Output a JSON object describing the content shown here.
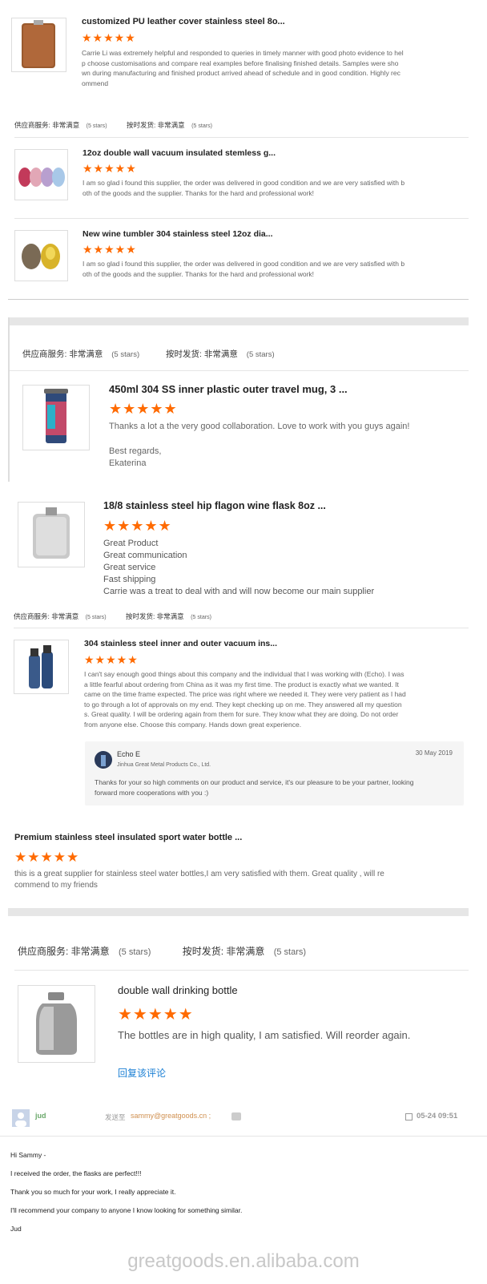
{
  "stars": "★★★★★",
  "meta_service_label": "供应商服务: 非常满意",
  "meta_ship_label": "按时发货: 非常满意",
  "meta_stars_text": "(5 stars)",
  "reviews_block1": [
    {
      "title": "customized PU leather cover stainless steel 8o...",
      "body": "Carrie Li was extremely helpful and responded to queries in timely manner with good photo evidence to hel\np choose customisations and compare real examples before finalising finished details. Samples were sho\nwn during manufacturing and finished product arrived ahead of schedule and in good condition. Highly rec\nommend"
    },
    {
      "title": "12oz double wall vacuum insulated stemless g...",
      "body": "I am so glad i found this supplier, the order was delivered in good condition and we are very satisfied with b\noth of the goods and the supplier. Thanks for the hard and professional work!"
    },
    {
      "title": "New wine tumbler 304 stainless steel 12oz dia...",
      "body": "I am so glad i found this supplier, the order was delivered in good condition and we are very satisfied with b\noth of the goods and the supplier. Thanks for the hard and professional work!"
    }
  ],
  "review_mug": {
    "title": "450ml 304 SS inner plastic outer travel mug, 3 ...",
    "body": "Thanks a lot a the very good collaboration. Love to work with you guys again!",
    "regards": "Best regards,\nEkaterina"
  },
  "review_flask": {
    "title": "18/8 stainless steel hip flagon wine flask 8oz ...",
    "lines": [
      "Great Product",
      "Great communication",
      "Great service",
      "Fast shipping",
      "Carrie was a treat to deal with and will now become our main supplier"
    ]
  },
  "review_vacuum": {
    "title": "304 stainless steel inner and outer vacuum ins...",
    "body": "I can't say enough good things about this company and the individual that I was working with (Echo).  I was\na little fearful about ordering from China as it was my first time.  The product is exactly what we wanted.  It\ncame on the time frame expected.  The price was right where we needed it.  They were very patient as I had\nto go through a lot of approvals on my end.  They kept checking up on me.  They answered all my question\ns.  Great quality.  I will be ordering again from them for sure.  They know what they are doing.  Do not order\nfrom anyone else.  Choose this company.  Hands down great experience.",
    "reply": {
      "name": "Echo E",
      "company": "Jinhua Great Metal Products Co., Ltd.",
      "date": "30 May 2019",
      "text": "Thanks for your so high comments on our product and service, it's our pleasure to be your partner, looking\nforward more cooperations with you :)"
    }
  },
  "review_sport": {
    "title": "Premium stainless steel insulated sport water bottle ...",
    "body": "this is a great supplier for stainless steel water bottles,I am very satisfied with them.  Great quality ,  will re\ncommend to my friends"
  },
  "review_bottle": {
    "title": "double wall drinking bottle",
    "body": "The bottles are in high quality, I am satisfied. Will reorder again.",
    "reply_link": "回复该评论"
  },
  "email": {
    "sender": "jud",
    "to_label": "发送至",
    "to_address": "sammy@greatgoods.cn ;",
    "date": "05-24 09:51",
    "lines": [
      "Hi Sammy -",
      "I received the order, the flasks are perfect!!!",
      "Thank you so much for your work, I really appreciate it.",
      "I'll recommend your company to anyone I know looking for something similar.",
      "Jud"
    ]
  },
  "watermark": "greatgoods.en.alibaba.com",
  "colors": {
    "star": "#ff6a00",
    "link": "#1a7fd4",
    "divider": "#e5e5e5",
    "band": "#e6e6e6"
  }
}
